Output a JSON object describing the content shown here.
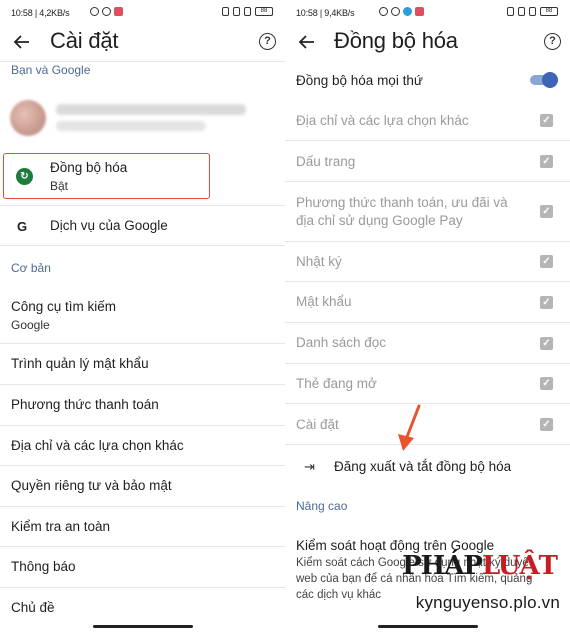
{
  "left": {
    "status": {
      "time": "10:58 | 4,2KB/s",
      "battery": "88"
    },
    "title": "Cài đặt",
    "help_icon": "?",
    "section_account": "Bạn và Google",
    "sync": {
      "title": "Đồng bộ hóa",
      "subtitle": "Bật",
      "icon": "↻"
    },
    "google_services": {
      "label": "Dịch vụ của Google",
      "icon": "G"
    },
    "section_basic": "Cơ bản",
    "search_engine": {
      "title": "Công cụ tìm kiếm",
      "subtitle": "Google"
    },
    "items": [
      "Trình quản lý mật khẩu",
      "Phương thức thanh toán",
      "Địa chỉ và các lựa chọn khác",
      "Quyền riêng tư và bảo mật",
      "Kiểm tra an toàn",
      "Thông báo",
      "Chủ đề"
    ]
  },
  "right": {
    "status": {
      "time": "10:58 | 9,4KB/s",
      "battery": "88"
    },
    "title": "Đồng bộ hóa",
    "help_icon": "?",
    "sync_everything": {
      "label": "Đồng bộ hóa mọi thứ",
      "on": true
    },
    "sync_items": [
      {
        "label": "Địa chỉ và các lựa chọn khác"
      },
      {
        "label": "Dấu trang"
      },
      {
        "label": "Phương thức thanh toán, ưu đãi và",
        "label2": "địa chỉ sử dụng Google Pay"
      },
      {
        "label": "Nhật ký"
      },
      {
        "label": "Mật khẩu"
      },
      {
        "label": "Danh sách đọc"
      },
      {
        "label": "Thẻ đang mở"
      },
      {
        "label": "Cài đặt"
      }
    ],
    "check_glyph": "✓",
    "signout": {
      "label": "Đăng xuất và tắt đồng bộ hóa",
      "icon": "⇥"
    },
    "section_advanced": "Nâng cao",
    "activity": {
      "title": "Kiểm soát hoạt động trên Google",
      "line1": "Kiểm soát cách Google sử dụng nhật ký duyệt",
      "line2": "web của bạn để cá nhân hóa Tìm kiếm, quảng",
      "line3": "các dịch vụ khác"
    }
  },
  "watermark": {
    "logo_part1": "PHÁP",
    "logo_part2": "LUẬT",
    "url": "kynguyenso.plo.vn"
  },
  "colors": {
    "accent": "#3f66b5",
    "section": "#4d6a92",
    "highlight": "#e24e3b",
    "arrow": "#e8542e",
    "sync_icon": "#1e7b3e"
  }
}
